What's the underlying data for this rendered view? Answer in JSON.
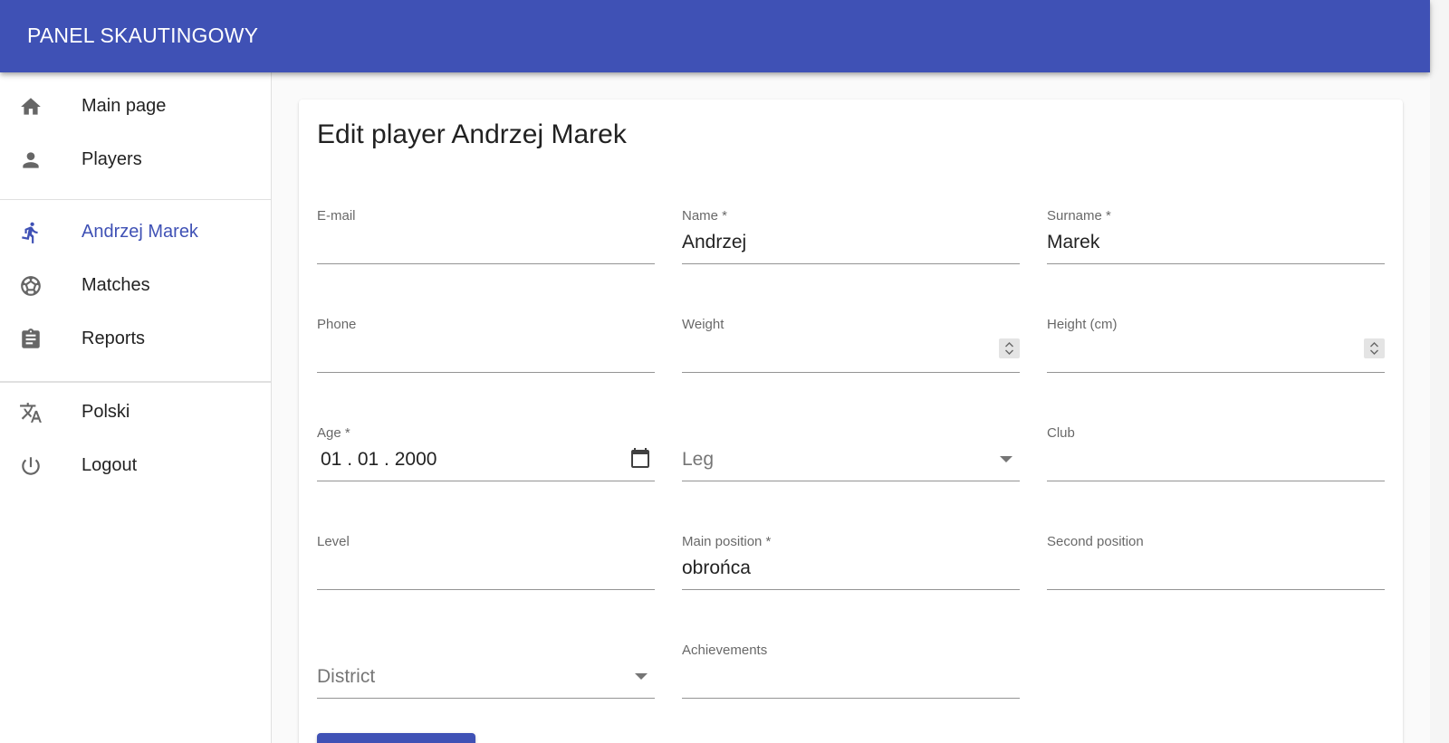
{
  "app": {
    "title": "PANEL SKAUTINGOWY"
  },
  "nav": {
    "main": [
      {
        "label": "Main page",
        "icon": "home-icon"
      },
      {
        "label": "Players",
        "icon": "person-icon"
      }
    ],
    "context": [
      {
        "label": "Andrzej Marek",
        "icon": "directions-run-icon",
        "active": true
      },
      {
        "label": "Matches",
        "icon": "sports-soccer-icon"
      },
      {
        "label": "Reports",
        "icon": "assignment-icon"
      }
    ],
    "footer": [
      {
        "label": "Polski",
        "icon": "translate-icon"
      },
      {
        "label": "Logout",
        "icon": "power-icon"
      }
    ]
  },
  "form": {
    "title": "Edit player Andrzej Marek",
    "fields": {
      "email": {
        "label": "E-mail",
        "value": ""
      },
      "name": {
        "label": "Name *",
        "value": "Andrzej"
      },
      "surname": {
        "label": "Surname *",
        "value": "Marek"
      },
      "phone": {
        "label": "Phone",
        "value": ""
      },
      "weight": {
        "label": "Weight",
        "value": ""
      },
      "height": {
        "label": "Height (cm)",
        "value": ""
      },
      "age": {
        "label": "Age *",
        "value": "01 . 01 . 2000"
      },
      "leg": {
        "placeholder": "Leg",
        "value": ""
      },
      "club": {
        "label": "Club",
        "value": ""
      },
      "level": {
        "label": "Level",
        "value": ""
      },
      "main_position": {
        "label": "Main position *",
        "value": "obrońca"
      },
      "second_position": {
        "label": "Second position",
        "value": ""
      },
      "district": {
        "placeholder": "District",
        "value": ""
      },
      "achievements": {
        "label": "Achievements",
        "value": ""
      }
    }
  },
  "colors": {
    "primary": "#3f51b5",
    "appbar_text": "#ffffff",
    "background": "#fafafa"
  }
}
